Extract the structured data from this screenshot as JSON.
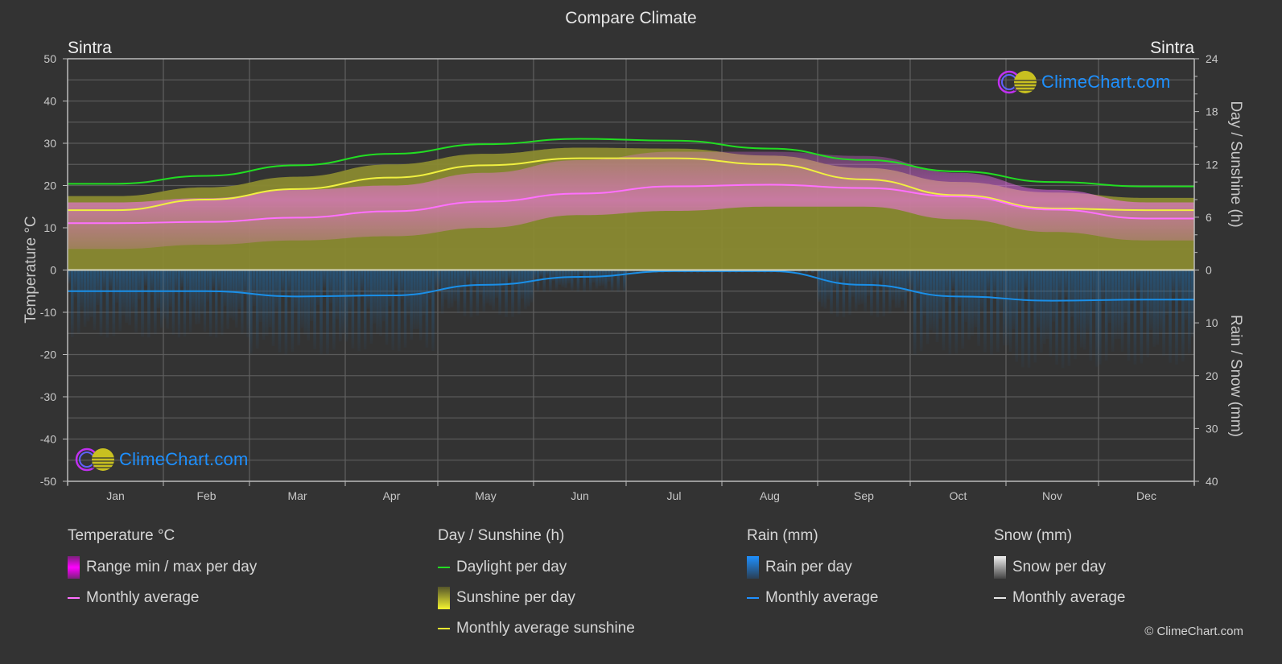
{
  "title": "Compare Climate",
  "location_left": "Sintra",
  "location_right": "Sintra",
  "watermark": "ClimeChart.com",
  "copyright": "© ClimeChart.com",
  "colors": {
    "background": "#333333",
    "temp_range": "#e040e0",
    "temp_avg": "#ff70ff",
    "daylight": "#22dd22",
    "sunshine_fill": "#8a8a30",
    "sunshine_avg": "#f0f040",
    "rain": "#1e90ff",
    "rain_avg": "#1a8fe8",
    "snow": "#ffffff",
    "logo_text": "#1e90ff"
  },
  "legend": {
    "temperature": {
      "title": "Temperature °C",
      "range": "Range min / max per day",
      "avg": "Monthly average"
    },
    "sun": {
      "title": "Day / Sunshine (h)",
      "daylight": "Daylight per day",
      "sunshine": "Sunshine per day",
      "avg": "Monthly average sunshine"
    },
    "rain": {
      "title": "Rain (mm)",
      "per_day": "Rain per day",
      "avg": "Monthly average"
    },
    "snow": {
      "title": "Snow (mm)",
      "per_day": "Snow per day",
      "avg": "Monthly average"
    }
  },
  "chart_data": {
    "type": "area",
    "title": "Compare Climate",
    "categories": [
      "Jan",
      "Feb",
      "Mar",
      "Apr",
      "May",
      "Jun",
      "Jul",
      "Aug",
      "Sep",
      "Oct",
      "Nov",
      "Dec"
    ],
    "axes": {
      "left": {
        "label": "Temperature °C",
        "range": [
          -50,
          50
        ],
        "ticks": [
          50,
          40,
          30,
          20,
          10,
          0,
          -10,
          -20,
          -30,
          -40,
          -50
        ]
      },
      "right_top": {
        "label": "Day / Sunshine (h)",
        "range": [
          0,
          24
        ],
        "ticks": [
          24,
          18,
          12,
          6,
          0
        ]
      },
      "right_bottom": {
        "label": "Rain / Snow (mm)",
        "range": [
          0,
          40
        ],
        "ticks": [
          0,
          10,
          20,
          30,
          40
        ]
      }
    },
    "grid": true,
    "series": [
      {
        "name": "Daylight per day",
        "unit": "h",
        "axis": "right_top",
        "values": [
          9.8,
          10.7,
          11.9,
          13.2,
          14.3,
          14.9,
          14.7,
          13.8,
          12.5,
          11.2,
          10.0,
          9.5
        ]
      },
      {
        "name": "Sunshine per day (max band)",
        "unit": "h",
        "axis": "right_top",
        "values": [
          8.4,
          9.4,
          10.6,
          12.0,
          13.2,
          13.9,
          13.8,
          13.0,
          11.6,
          10.0,
          8.8,
          8.2
        ]
      },
      {
        "name": "Monthly average sunshine",
        "unit": "h",
        "axis": "right_top",
        "values": [
          6.8,
          8.0,
          9.2,
          10.5,
          11.9,
          12.7,
          12.7,
          12.0,
          10.3,
          8.5,
          7.0,
          6.8
        ]
      },
      {
        "name": "Temperature monthly average",
        "unit": "°C",
        "axis": "left",
        "values": [
          11.1,
          11.4,
          12.4,
          13.9,
          16.2,
          18.1,
          19.8,
          20.2,
          19.4,
          17.4,
          14.3,
          12.2
        ]
      },
      {
        "name": "Temperature daily max (range top)",
        "unit": "°C",
        "axis": "left",
        "values": [
          16,
          17,
          19,
          20,
          23,
          26,
          28,
          28,
          27,
          23,
          19,
          16
        ]
      },
      {
        "name": "Temperature daily min (range bottom)",
        "unit": "°C",
        "axis": "left",
        "values": [
          5,
          6,
          7,
          8,
          10,
          13,
          14,
          15,
          15,
          12,
          9,
          7
        ]
      },
      {
        "name": "Rain monthly average",
        "unit": "mm",
        "axis": "right_bottom",
        "values": [
          4.0,
          4.0,
          5.0,
          4.8,
          2.8,
          1.3,
          0.2,
          0.2,
          2.8,
          5.0,
          5.8,
          5.6
        ]
      },
      {
        "name": "Snow monthly average",
        "unit": "mm",
        "axis": "right_bottom",
        "values": [
          0,
          0,
          0,
          0,
          0,
          0,
          0,
          0,
          0,
          0,
          0,
          0
        ]
      }
    ]
  }
}
